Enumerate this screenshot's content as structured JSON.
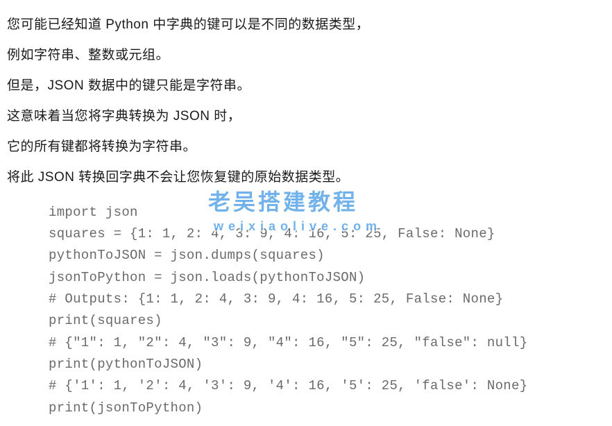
{
  "prose": [
    "您可能已经知道 Python 中字典的键可以是不同的数据类型，",
    "例如字符串、整数或元组。",
    "但是，JSON 数据中的键只能是字符串。",
    "这意味着当您将字典转换为 JSON 时，",
    "它的所有键都将转换为字符串。",
    "将此 JSON 转换回字典不会让您恢复键的原始数据类型。"
  ],
  "code": "import json\nsquares = {1: 1, 2: 4, 3: 9, 4: 16, 5: 25, False: None}\npythonToJSON = json.dumps(squares)\njsonToPython = json.loads(pythonToJSON)\n# Outputs: {1: 1, 2: 4, 3: 9, 4: 16, 5: 25, False: None}\nprint(squares)\n# {\"1\": 1, \"2\": 4, \"3\": 9, \"4\": 16, \"5\": 25, \"false\": null}\nprint(pythonToJSON)\n# {'1': 1, '2': 4, '3': 9, '4': 16, '5': 25, 'false': None}\nprint(jsonToPython)",
  "watermark": {
    "main": "老吴搭建教程",
    "sub": "weixiaolive.com"
  }
}
